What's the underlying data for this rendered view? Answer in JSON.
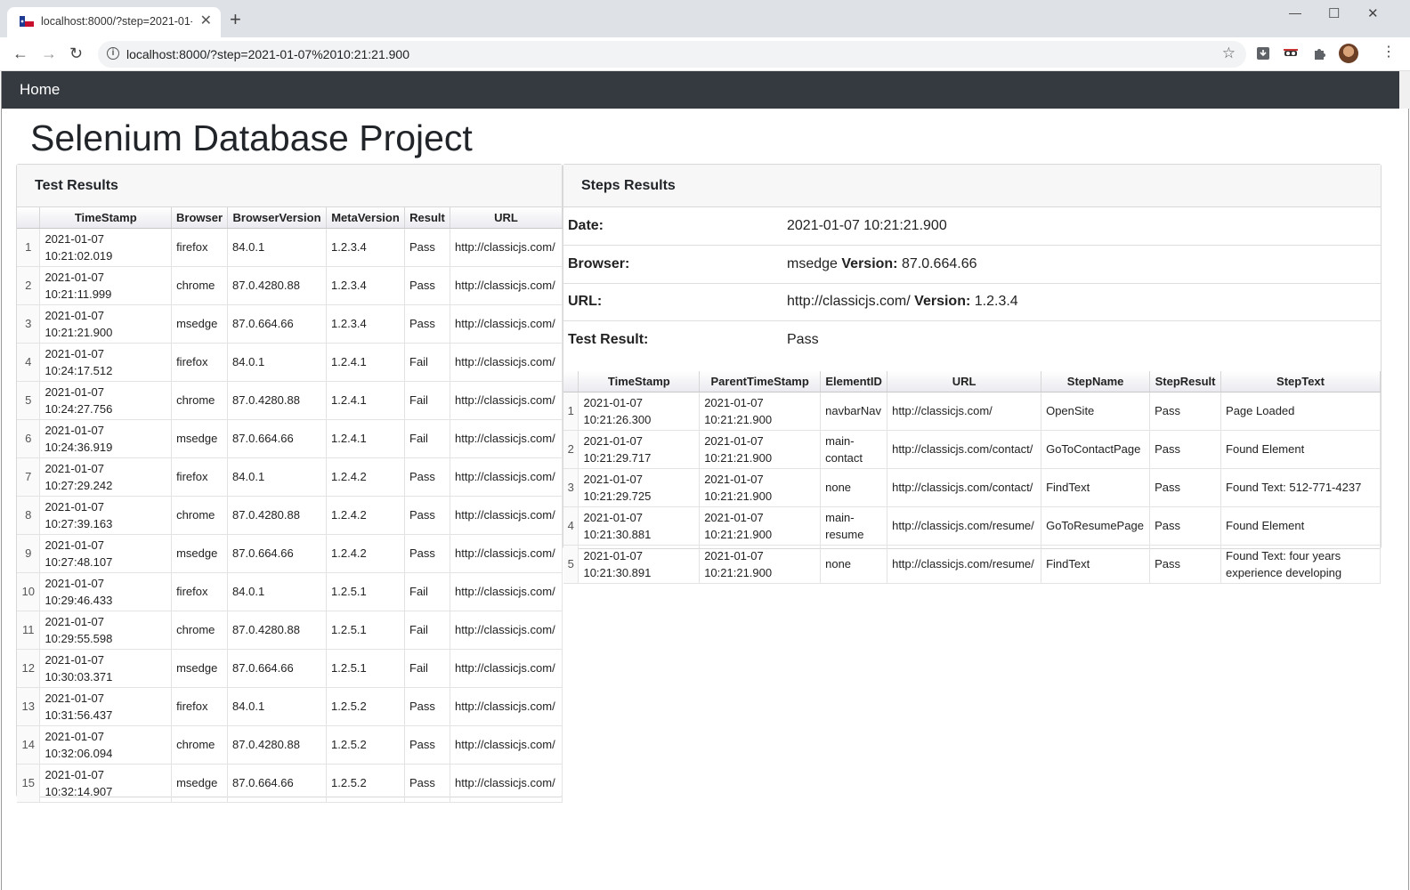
{
  "browser": {
    "tab_title": "localhost:8000/?step=2021-01-0",
    "url": "localhost:8000/?step=2021-01-07%2010:21:21.900"
  },
  "navbar": {
    "brand": "Home"
  },
  "page_title": "Selenium Database Project",
  "test_results": {
    "header": "Test Results",
    "columns": [
      "",
      "TimeStamp",
      "Browser",
      "BrowserVersion",
      "MetaVersion",
      "Result",
      "URL"
    ],
    "rows": [
      [
        "1",
        "2021-01-07",
        "10:21:02.019",
        "firefox",
        "84.0.1",
        "1.2.3.4",
        "Pass",
        "http://classicjs.com/"
      ],
      [
        "2",
        "2021-01-07",
        "10:21:11.999",
        "chrome",
        "87.0.4280.88",
        "1.2.3.4",
        "Pass",
        "http://classicjs.com/"
      ],
      [
        "3",
        "2021-01-07",
        "10:21:21.900",
        "msedge",
        "87.0.664.66",
        "1.2.3.4",
        "Pass",
        "http://classicjs.com/"
      ],
      [
        "4",
        "2021-01-07",
        "10:24:17.512",
        "firefox",
        "84.0.1",
        "1.2.4.1",
        "Fail",
        "http://classicjs.com/"
      ],
      [
        "5",
        "2021-01-07",
        "10:24:27.756",
        "chrome",
        "87.0.4280.88",
        "1.2.4.1",
        "Fail",
        "http://classicjs.com/"
      ],
      [
        "6",
        "2021-01-07",
        "10:24:36.919",
        "msedge",
        "87.0.664.66",
        "1.2.4.1",
        "Fail",
        "http://classicjs.com/"
      ],
      [
        "7",
        "2021-01-07",
        "10:27:29.242",
        "firefox",
        "84.0.1",
        "1.2.4.2",
        "Pass",
        "http://classicjs.com/"
      ],
      [
        "8",
        "2021-01-07",
        "10:27:39.163",
        "chrome",
        "87.0.4280.88",
        "1.2.4.2",
        "Pass",
        "http://classicjs.com/"
      ],
      [
        "9",
        "2021-01-07",
        "10:27:48.107",
        "msedge",
        "87.0.664.66",
        "1.2.4.2",
        "Pass",
        "http://classicjs.com/"
      ],
      [
        "10",
        "2021-01-07",
        "10:29:46.433",
        "firefox",
        "84.0.1",
        "1.2.5.1",
        "Fail",
        "http://classicjs.com/"
      ],
      [
        "11",
        "2021-01-07",
        "10:29:55.598",
        "chrome",
        "87.0.4280.88",
        "1.2.5.1",
        "Fail",
        "http://classicjs.com/"
      ],
      [
        "12",
        "2021-01-07",
        "10:30:03.371",
        "msedge",
        "87.0.664.66",
        "1.2.5.1",
        "Fail",
        "http://classicjs.com/"
      ],
      [
        "13",
        "2021-01-07",
        "10:31:56.437",
        "firefox",
        "84.0.1",
        "1.2.5.2",
        "Pass",
        "http://classicjs.com/"
      ],
      [
        "14",
        "2021-01-07",
        "10:32:06.094",
        "chrome",
        "87.0.4280.88",
        "1.2.5.2",
        "Pass",
        "http://classicjs.com/"
      ],
      [
        "15",
        "2021-01-07",
        "10:32:14.907",
        "msedge",
        "87.0.664.66",
        "1.2.5.2",
        "Pass",
        "http://classicjs.com/"
      ]
    ]
  },
  "steps_results": {
    "header": "Steps Results",
    "info": {
      "date_label": "Date:",
      "date_value": "2021-01-07 10:21:21.900",
      "browser_label": "Browser:",
      "browser_value": "msedge",
      "version_label": "Version:",
      "browser_version": "87.0.664.66",
      "url_label": "URL:",
      "url_value": "http://classicjs.com/",
      "meta_version": "1.2.3.4",
      "result_label": "Test Result:",
      "result_value": "Pass"
    },
    "columns": [
      "",
      "TimeStamp",
      "ParentTimeStamp",
      "ElementID",
      "URL",
      "StepName",
      "StepResult",
      "StepText"
    ],
    "rows": [
      [
        "1",
        "2021-01-07",
        "10:21:26.300",
        "2021-01-07",
        "10:21:21.900",
        "navbarNav",
        "",
        "http://classicjs.com/",
        "OpenSite",
        "Pass",
        "Page Loaded",
        ""
      ],
      [
        "2",
        "2021-01-07",
        "10:21:29.717",
        "2021-01-07",
        "10:21:21.900",
        "main-",
        "contact",
        "http://classicjs.com/contact/",
        "GoToContactPage",
        "Pass",
        "Found Element",
        ""
      ],
      [
        "3",
        "2021-01-07",
        "10:21:29.725",
        "2021-01-07",
        "10:21:21.900",
        "none",
        "",
        "http://classicjs.com/contact/",
        "FindText",
        "Pass",
        "Found Text: 512-771-4237",
        ""
      ],
      [
        "4",
        "2021-01-07",
        "10:21:30.881",
        "2021-01-07",
        "10:21:21.900",
        "main-",
        "resume",
        "http://classicjs.com/resume/",
        "GoToResumePage",
        "Pass",
        "Found Element",
        ""
      ],
      [
        "5",
        "2021-01-07",
        "10:21:30.891",
        "2021-01-07",
        "10:21:21.900",
        "none",
        "",
        "http://classicjs.com/resume/",
        "FindText",
        "Pass",
        "Found Text: four years",
        "experience developing"
      ]
    ]
  }
}
